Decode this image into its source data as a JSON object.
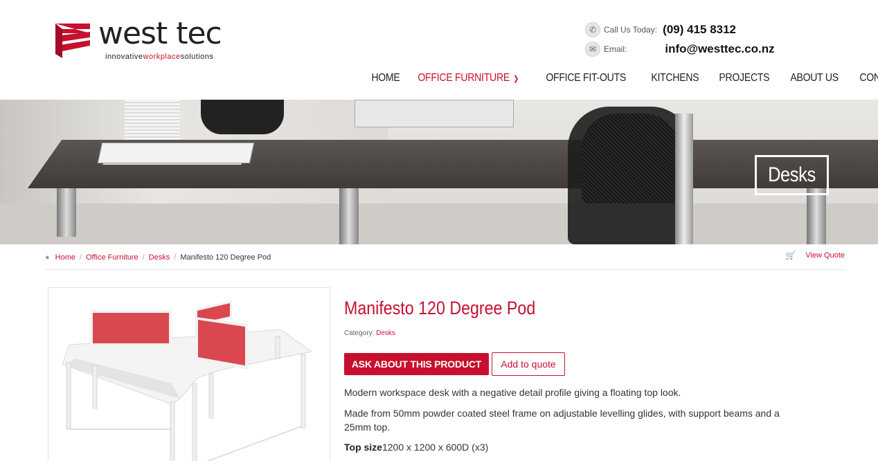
{
  "header": {
    "logo_name": "west tec",
    "logo_tag_part1": "innovative",
    "logo_tag_part2": "workplace",
    "logo_tag_part3": "solutions",
    "phone_label": "Call Us Today:",
    "phone_value": "(09) 415 8312",
    "email_label": "Email:",
    "email_value": "info@westtec.co.nz",
    "phone_icon": "phone-icon",
    "email_icon": "envelope-icon"
  },
  "nav": {
    "items": [
      {
        "label": "HOME"
      },
      {
        "label": "OFFICE FURNITURE"
      },
      {
        "label": "OFFICE FIT-OUTS"
      },
      {
        "label": "KITCHENS"
      },
      {
        "label": "PROJECTS"
      },
      {
        "label": "ABOUT US"
      },
      {
        "label": "CONTACT"
      }
    ]
  },
  "hero": {
    "title": "Desks"
  },
  "breadcrumb": {
    "items": [
      "Home",
      "Office Furniture",
      "Desks"
    ],
    "current": "Manifesto 120 Degree Pod",
    "view_quote": "View Quote"
  },
  "product": {
    "title": "Manifesto 120 Degree Pod",
    "category_label": "Category:",
    "category_value": "Desks",
    "ask_button": "ASK ABOUT THIS PRODUCT",
    "quote_button": "Add to quote",
    "desc1": "Modern workspace desk with a negative detail profile giving a floating top look.",
    "desc2": "Made from 50mm powder coated steel frame on adjustable levelling glides, with support beams and a 25mm top.",
    "top_size_label": "Top size",
    "top_size_value": "1200 x 1200 x 600D (x3)"
  },
  "colors": {
    "accent": "#c8102e",
    "text": "#333333"
  }
}
